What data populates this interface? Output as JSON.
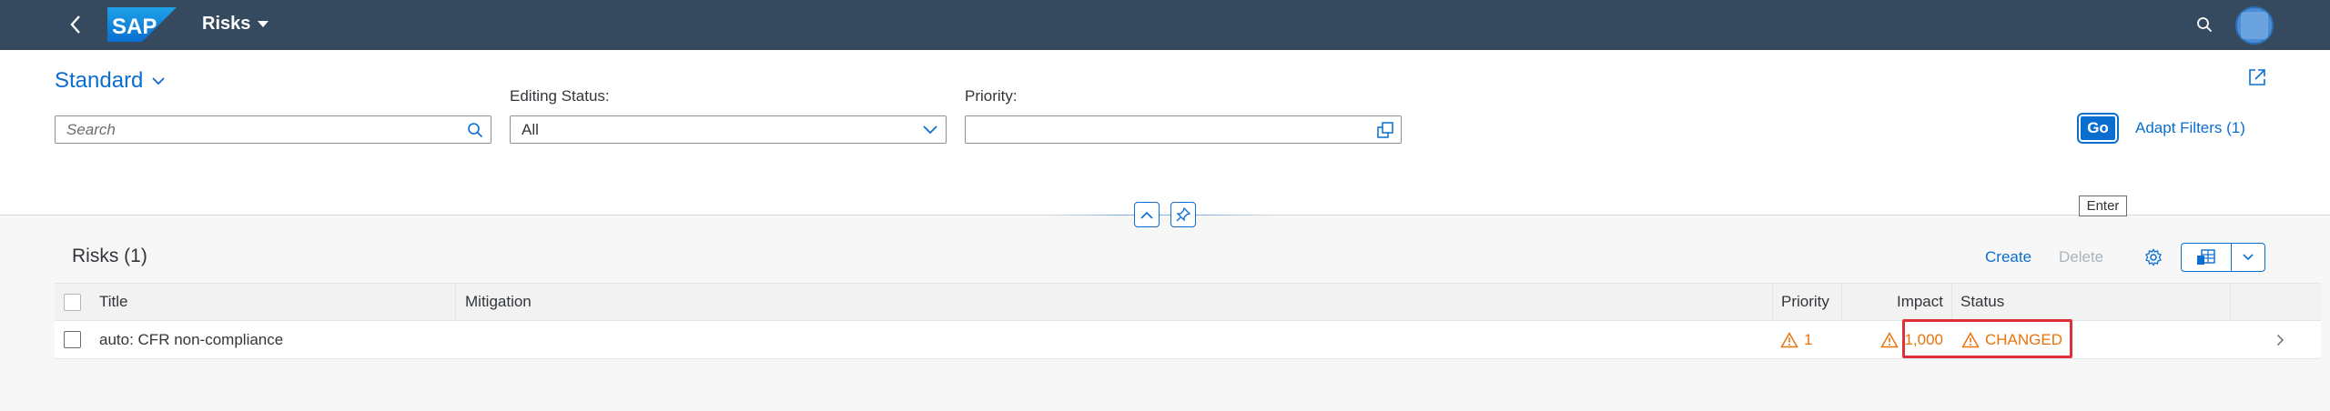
{
  "shell": {
    "app_title": "Risks",
    "logo_text": "SAP"
  },
  "header": {
    "variant_title": "Standard",
    "search": {
      "placeholder": "Search",
      "value": ""
    },
    "editing_status": {
      "label": "Editing Status:",
      "value": "All"
    },
    "priority": {
      "label": "Priority:",
      "value": ""
    },
    "go_label": "Go",
    "go_tooltip": "Enter",
    "adapt_filters_label": "Adapt Filters (1)"
  },
  "table": {
    "title": "Risks (1)",
    "create_label": "Create",
    "delete_label": "Delete",
    "columns": {
      "title": "Title",
      "mitigation": "Mitigation",
      "priority": "Priority",
      "impact": "Impact",
      "status": "Status"
    },
    "rows": [
      {
        "title": "auto: CFR non-compliance",
        "mitigation": "",
        "priority": "1",
        "impact": "1,000",
        "status": "CHANGED"
      }
    ]
  },
  "colors": {
    "shell_bg": "#354a5f",
    "accent": "#0a6ed1",
    "warning": "#e9730c",
    "highlight_box": "#e0313a"
  }
}
